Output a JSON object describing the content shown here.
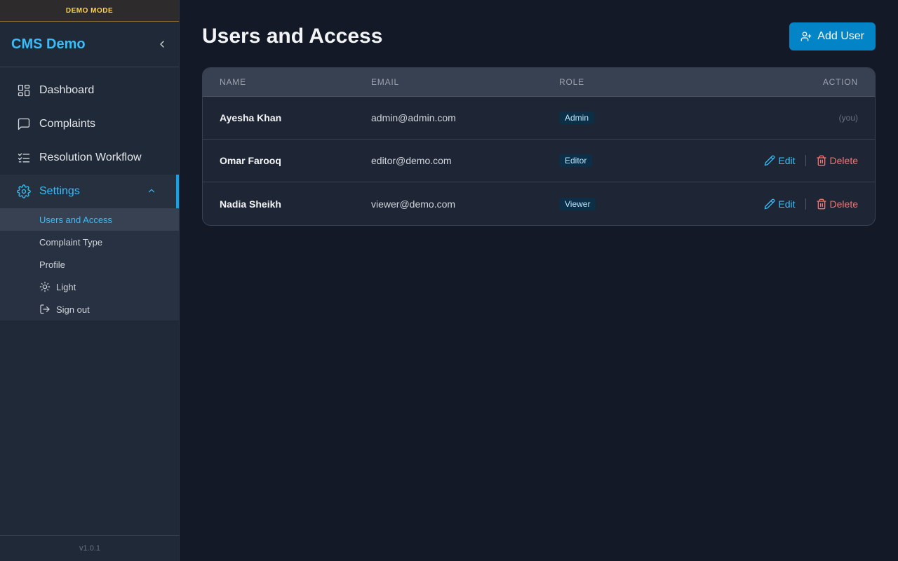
{
  "banner": "DEMO MODE",
  "brand": {
    "title": "CMS Demo"
  },
  "nav": {
    "dashboard": "Dashboard",
    "complaints": "Complaints",
    "workflow": "Resolution Workflow",
    "settings": "Settings"
  },
  "settings_sub": {
    "users": "Users and Access",
    "complaint_type": "Complaint Type",
    "profile": "Profile",
    "theme": "Light",
    "signout": "Sign out"
  },
  "version": "v1.0.1",
  "page": {
    "title": "Users and Access",
    "add_button": "Add User"
  },
  "table": {
    "headers": {
      "name": "NAME",
      "email": "EMAIL",
      "role": "ROLE",
      "action": "ACTION"
    },
    "rows": [
      {
        "name": "Ayesha Khan",
        "email": "admin@admin.com",
        "role": "Admin",
        "self": "(you)"
      },
      {
        "name": "Omar Farooq",
        "email": "editor@demo.com",
        "role": "Editor",
        "edit": "Edit",
        "delete": "Delete"
      },
      {
        "name": "Nadia Sheikh",
        "email": "viewer@demo.com",
        "role": "Viewer",
        "edit": "Edit",
        "delete": "Delete"
      }
    ]
  },
  "colors": {
    "accent": "#38bdf8",
    "primary_button": "#0284c7",
    "danger": "#f87171"
  }
}
